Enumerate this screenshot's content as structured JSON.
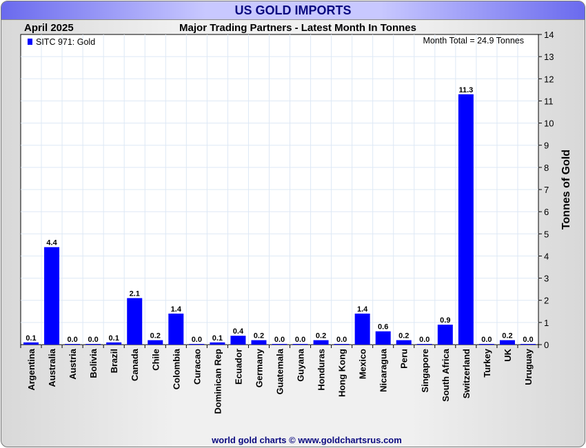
{
  "title": "US GOLD IMPORTS",
  "footer": "world gold charts © www.goldchartsrus.com",
  "chart_data": {
    "type": "bar",
    "title": "Major Trading Partners - Latest Month In Tonnes",
    "period": "April 2025",
    "legend": "SITC 971: Gold",
    "legend_position": "top-left",
    "annotation": "Month Total = 24.9 Tonnes",
    "ylabel": "Tonnes of Gold",
    "ylim": [
      0,
      14
    ],
    "yticks": [
      0,
      1,
      2,
      3,
      4,
      5,
      6,
      7,
      8,
      9,
      10,
      11,
      12,
      13,
      14
    ],
    "grid": true,
    "bar_color": "#0000ff",
    "categories": [
      "Argentina",
      "Australia",
      "Austria",
      "Bolivia",
      "Brazil",
      "Canada",
      "Chile",
      "Colombia",
      "Curacao",
      "Dominican Rep",
      "Ecuador",
      "Germany",
      "Guatemala",
      "Guyana",
      "Honduras",
      "Hong Kong",
      "Mexico",
      "Nicaragua",
      "Peru",
      "Singapore",
      "South Africa",
      "Switzerland",
      "Turkey",
      "UK",
      "Uruguay"
    ],
    "values": [
      0.1,
      4.4,
      0.0,
      0.0,
      0.1,
      2.1,
      0.2,
      1.4,
      0.0,
      0.1,
      0.4,
      0.2,
      0.0,
      0.0,
      0.2,
      0.0,
      1.4,
      0.6,
      0.2,
      0.0,
      0.9,
      11.3,
      0.0,
      0.2,
      0.0
    ]
  }
}
